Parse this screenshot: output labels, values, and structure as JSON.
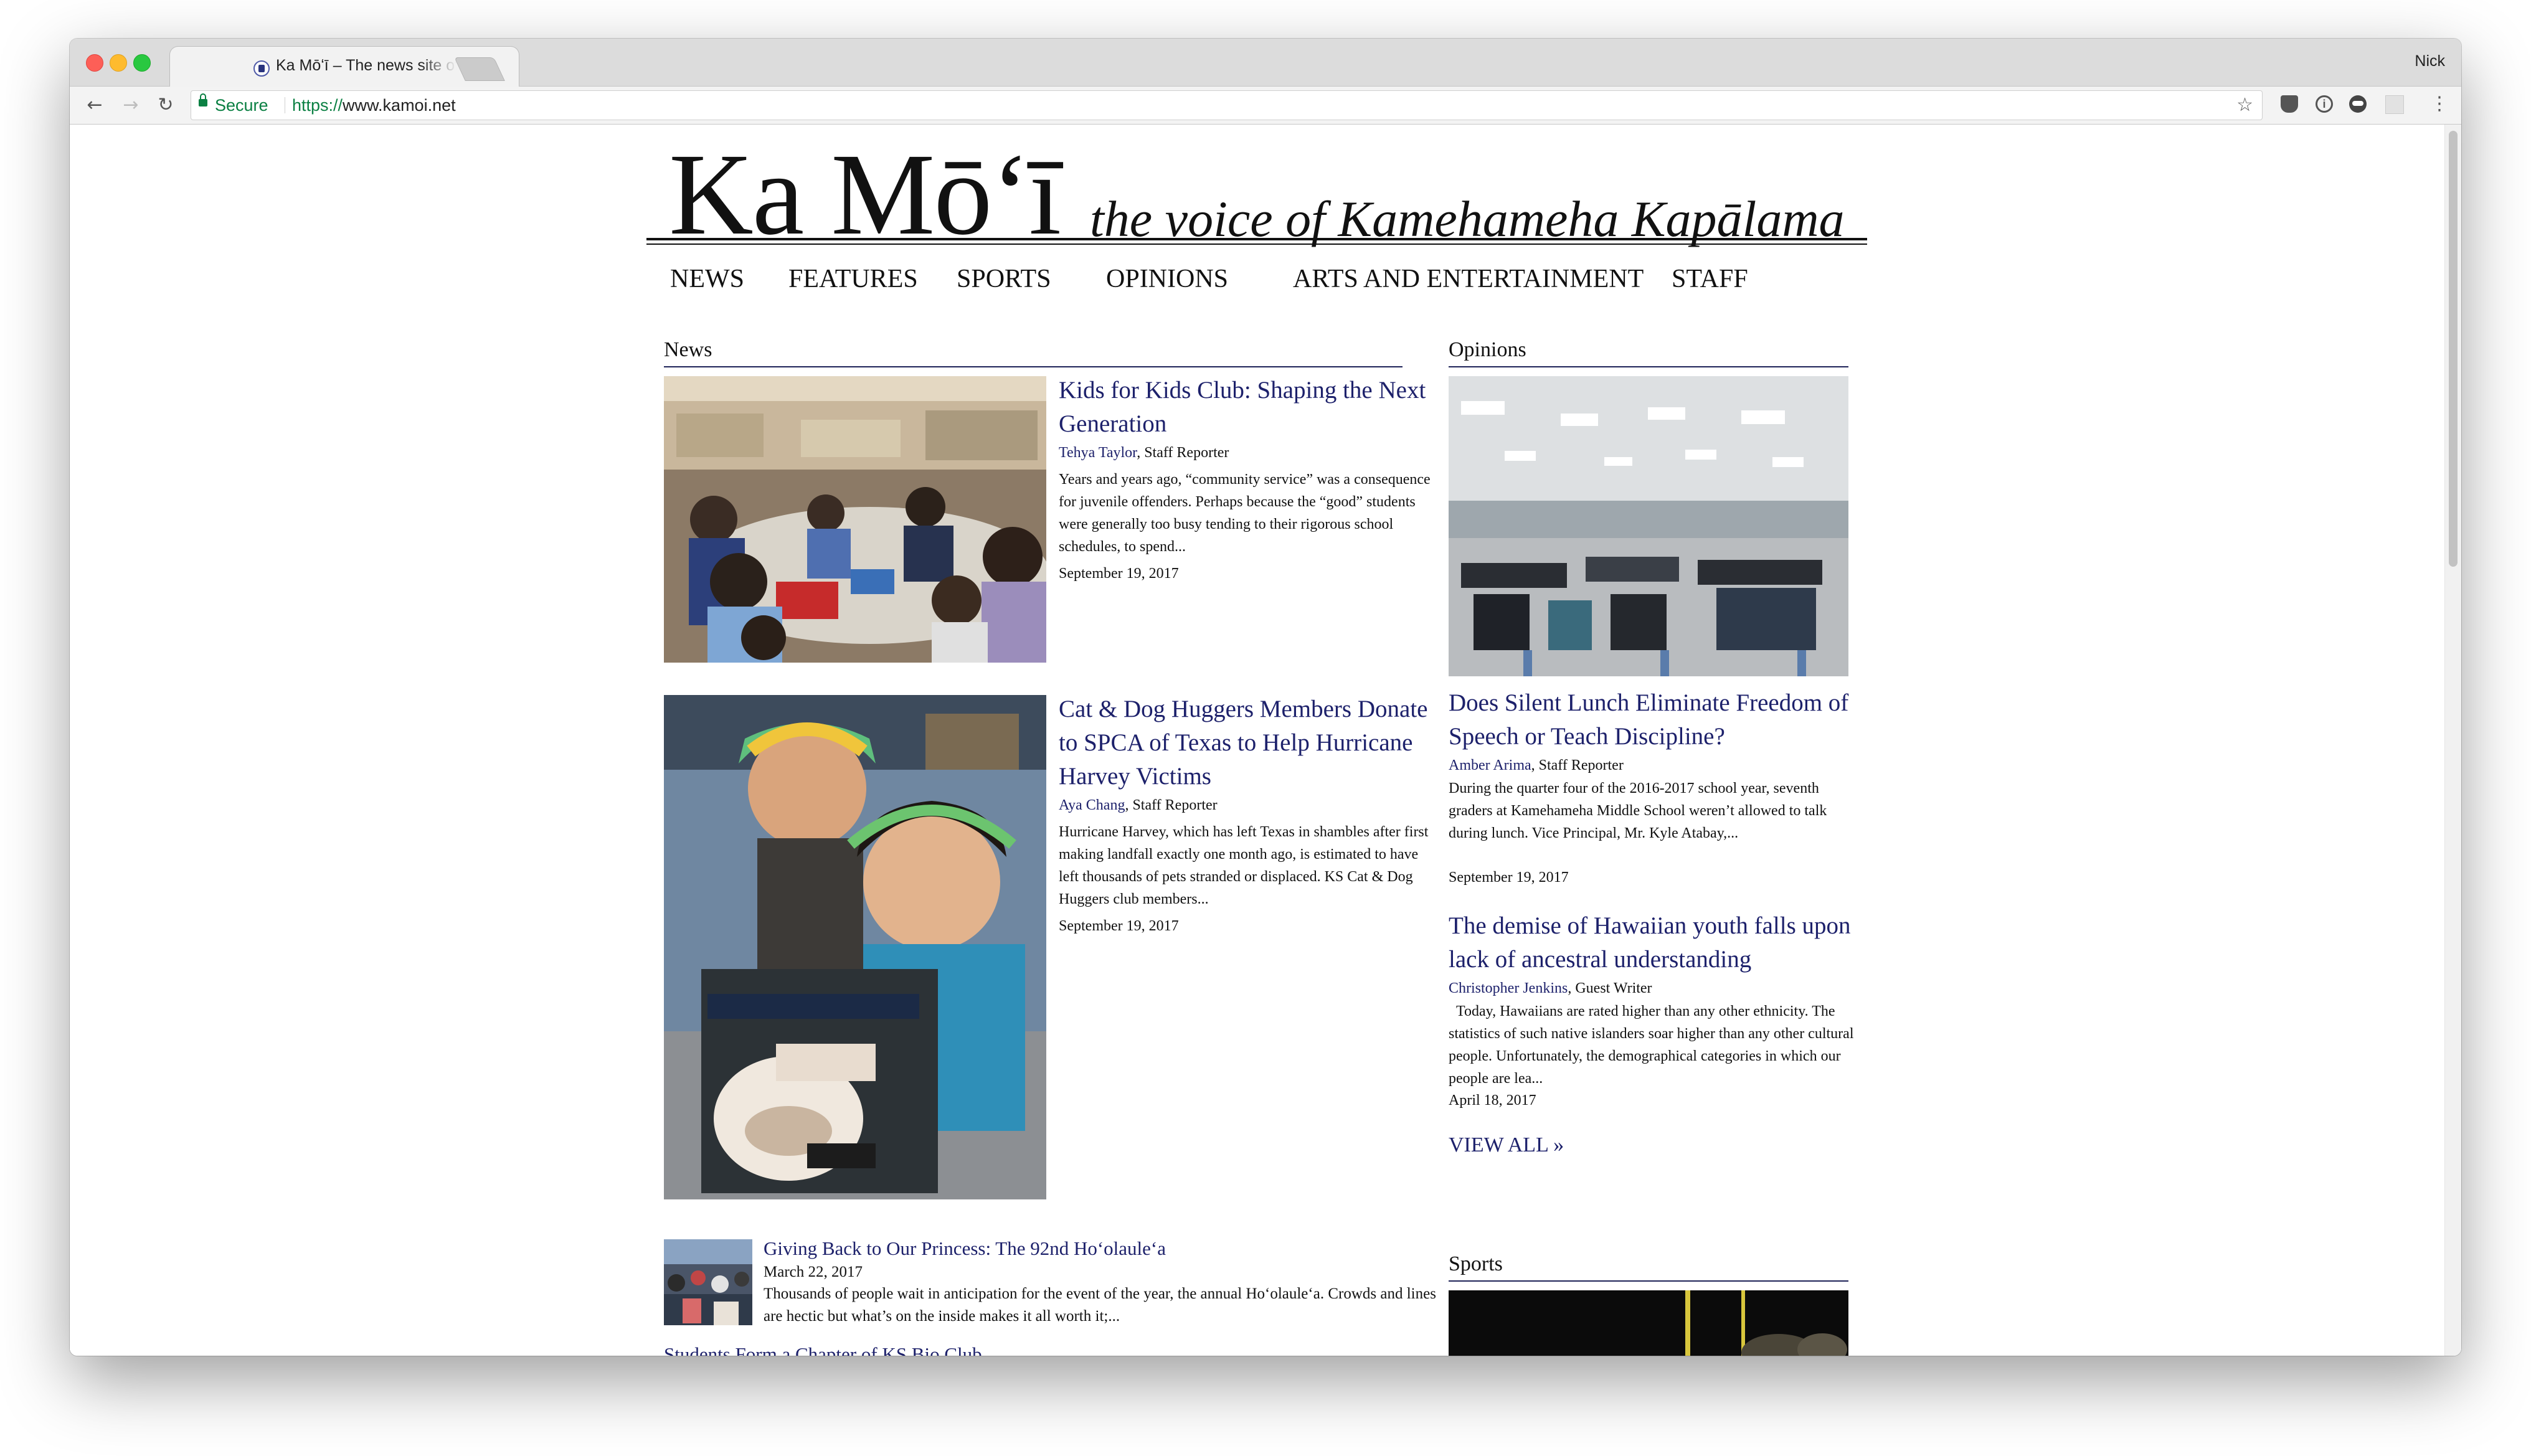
{
  "browser": {
    "tab_title": "Ka Mōʻī – The news site of Kamehameha Kapālama",
    "tab_close": "×",
    "profile_name": "Nick",
    "secure_label": "Secure",
    "url_scheme": "https://",
    "url_host": "www.kamoi.net",
    "bookmark_star": "☆",
    "back_glyph": "←",
    "forward_glyph": "→",
    "reload_glyph": "↻",
    "menu_glyph": "⋮",
    "info_glyph": "i"
  },
  "site": {
    "logo_text": "Ka Mōʻī",
    "tagline": "the voice of Kamehameha Kapālama",
    "nav": [
      "NEWS",
      "FEATURES",
      "SPORTS",
      "OPINIONS",
      "ARTS AND ENTERTAINMENT",
      "STAFF"
    ]
  },
  "news": {
    "heading": "News",
    "articles": [
      {
        "title": "Kids for Kids Club: Shaping the Next Generation",
        "author": "Tehya Taylor",
        "role": ", Staff Reporter",
        "excerpt": "Years and years ago, “community service” was a consequence for juvenile offenders. Perhaps because the “good” students were generally too busy tending to their rigorous school schedules, to spend...",
        "date": "September 19, 2017"
      },
      {
        "title": "Cat & Dog Huggers Members Donate to SPCA of Texas to Help Hurricane Harvey Victims",
        "author": "Aya Chang",
        "role": ", Staff Reporter",
        "excerpt": "Hurricane Harvey, which has left Texas in shambles after first making landfall exactly one month ago, is estimated to have left thousands of pets stranded or displaced. KS Cat & Dog Huggers club members...",
        "date": "September 19, 2017"
      }
    ],
    "small_article": {
      "title": "Giving Back to Our Princess: The 92nd Hoʻolauleʻa",
      "date": "March 22, 2017",
      "excerpt": "Thousands of people wait in anticipation for the event of the year, the annual Hoʻolauleʻa. Crowds and lines are hectic but what’s on the inside makes it all worth it;..."
    },
    "cut_off_link": "Students Form a Chapter of KS Bio Club..."
  },
  "opinions": {
    "heading": "Opinions",
    "articles": [
      {
        "title": "Does Silent Lunch Eliminate Freedom of Speech or Teach Discipline?",
        "author": "Amber Arima",
        "role": ", Staff Reporter",
        "excerpt": "During the quarter four of the 2016-2017 school year, seventh graders at Kamehameha Middle School weren’t allowed to talk during lunch. Vice Principal, Mr. Kyle Atabay,...",
        "date": "September 19, 2017"
      },
      {
        "title": "The demise of Hawaiian youth falls upon lack of ancestral understanding",
        "author": "Christopher Jenkins",
        "role": ", Guest Writer",
        "excerpt": "  Today, Hawaiians are rated higher than any other ethnicity. The statistics of such native islanders soar higher than any other cultural people. Unfortunately, the demographical categories in which our people are lea...",
        "date": "April 18, 2017"
      }
    ],
    "view_all": "VIEW ALL »"
  },
  "sports": {
    "heading": "Sports"
  }
}
